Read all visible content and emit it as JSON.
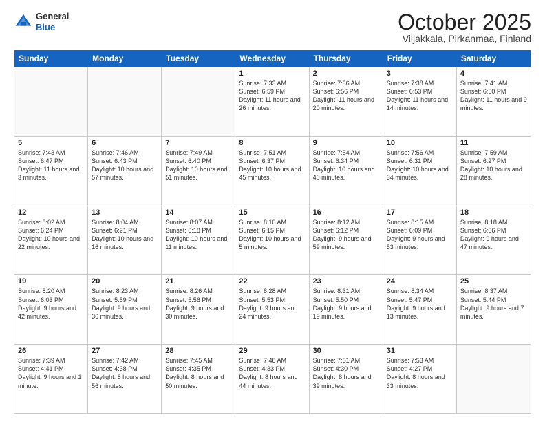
{
  "header": {
    "logo_general": "General",
    "logo_blue": "Blue",
    "month": "October 2025",
    "location": "Viljakkala, Pirkanmaa, Finland"
  },
  "weekdays": [
    "Sunday",
    "Monday",
    "Tuesday",
    "Wednesday",
    "Thursday",
    "Friday",
    "Saturday"
  ],
  "rows": [
    [
      {
        "day": "",
        "info": ""
      },
      {
        "day": "",
        "info": ""
      },
      {
        "day": "",
        "info": ""
      },
      {
        "day": "1",
        "info": "Sunrise: 7:33 AM\nSunset: 6:59 PM\nDaylight: 11 hours and 26 minutes."
      },
      {
        "day": "2",
        "info": "Sunrise: 7:36 AM\nSunset: 6:56 PM\nDaylight: 11 hours and 20 minutes."
      },
      {
        "day": "3",
        "info": "Sunrise: 7:38 AM\nSunset: 6:53 PM\nDaylight: 11 hours and 14 minutes."
      },
      {
        "day": "4",
        "info": "Sunrise: 7:41 AM\nSunset: 6:50 PM\nDaylight: 11 hours and 9 minutes."
      }
    ],
    [
      {
        "day": "5",
        "info": "Sunrise: 7:43 AM\nSunset: 6:47 PM\nDaylight: 11 hours and 3 minutes."
      },
      {
        "day": "6",
        "info": "Sunrise: 7:46 AM\nSunset: 6:43 PM\nDaylight: 10 hours and 57 minutes."
      },
      {
        "day": "7",
        "info": "Sunrise: 7:49 AM\nSunset: 6:40 PM\nDaylight: 10 hours and 51 minutes."
      },
      {
        "day": "8",
        "info": "Sunrise: 7:51 AM\nSunset: 6:37 PM\nDaylight: 10 hours and 45 minutes."
      },
      {
        "day": "9",
        "info": "Sunrise: 7:54 AM\nSunset: 6:34 PM\nDaylight: 10 hours and 40 minutes."
      },
      {
        "day": "10",
        "info": "Sunrise: 7:56 AM\nSunset: 6:31 PM\nDaylight: 10 hours and 34 minutes."
      },
      {
        "day": "11",
        "info": "Sunrise: 7:59 AM\nSunset: 6:27 PM\nDaylight: 10 hours and 28 minutes."
      }
    ],
    [
      {
        "day": "12",
        "info": "Sunrise: 8:02 AM\nSunset: 6:24 PM\nDaylight: 10 hours and 22 minutes."
      },
      {
        "day": "13",
        "info": "Sunrise: 8:04 AM\nSunset: 6:21 PM\nDaylight: 10 hours and 16 minutes."
      },
      {
        "day": "14",
        "info": "Sunrise: 8:07 AM\nSunset: 6:18 PM\nDaylight: 10 hours and 11 minutes."
      },
      {
        "day": "15",
        "info": "Sunrise: 8:10 AM\nSunset: 6:15 PM\nDaylight: 10 hours and 5 minutes."
      },
      {
        "day": "16",
        "info": "Sunrise: 8:12 AM\nSunset: 6:12 PM\nDaylight: 9 hours and 59 minutes."
      },
      {
        "day": "17",
        "info": "Sunrise: 8:15 AM\nSunset: 6:09 PM\nDaylight: 9 hours and 53 minutes."
      },
      {
        "day": "18",
        "info": "Sunrise: 8:18 AM\nSunset: 6:06 PM\nDaylight: 9 hours and 47 minutes."
      }
    ],
    [
      {
        "day": "19",
        "info": "Sunrise: 8:20 AM\nSunset: 6:03 PM\nDaylight: 9 hours and 42 minutes."
      },
      {
        "day": "20",
        "info": "Sunrise: 8:23 AM\nSunset: 5:59 PM\nDaylight: 9 hours and 36 minutes."
      },
      {
        "day": "21",
        "info": "Sunrise: 8:26 AM\nSunset: 5:56 PM\nDaylight: 9 hours and 30 minutes."
      },
      {
        "day": "22",
        "info": "Sunrise: 8:28 AM\nSunset: 5:53 PM\nDaylight: 9 hours and 24 minutes."
      },
      {
        "day": "23",
        "info": "Sunrise: 8:31 AM\nSunset: 5:50 PM\nDaylight: 9 hours and 19 minutes."
      },
      {
        "day": "24",
        "info": "Sunrise: 8:34 AM\nSunset: 5:47 PM\nDaylight: 9 hours and 13 minutes."
      },
      {
        "day": "25",
        "info": "Sunrise: 8:37 AM\nSunset: 5:44 PM\nDaylight: 9 hours and 7 minutes."
      }
    ],
    [
      {
        "day": "26",
        "info": "Sunrise: 7:39 AM\nSunset: 4:41 PM\nDaylight: 9 hours and 1 minute."
      },
      {
        "day": "27",
        "info": "Sunrise: 7:42 AM\nSunset: 4:38 PM\nDaylight: 8 hours and 56 minutes."
      },
      {
        "day": "28",
        "info": "Sunrise: 7:45 AM\nSunset: 4:35 PM\nDaylight: 8 hours and 50 minutes."
      },
      {
        "day": "29",
        "info": "Sunrise: 7:48 AM\nSunset: 4:33 PM\nDaylight: 8 hours and 44 minutes."
      },
      {
        "day": "30",
        "info": "Sunrise: 7:51 AM\nSunset: 4:30 PM\nDaylight: 8 hours and 39 minutes."
      },
      {
        "day": "31",
        "info": "Sunrise: 7:53 AM\nSunset: 4:27 PM\nDaylight: 8 hours and 33 minutes."
      },
      {
        "day": "",
        "info": ""
      }
    ]
  ]
}
